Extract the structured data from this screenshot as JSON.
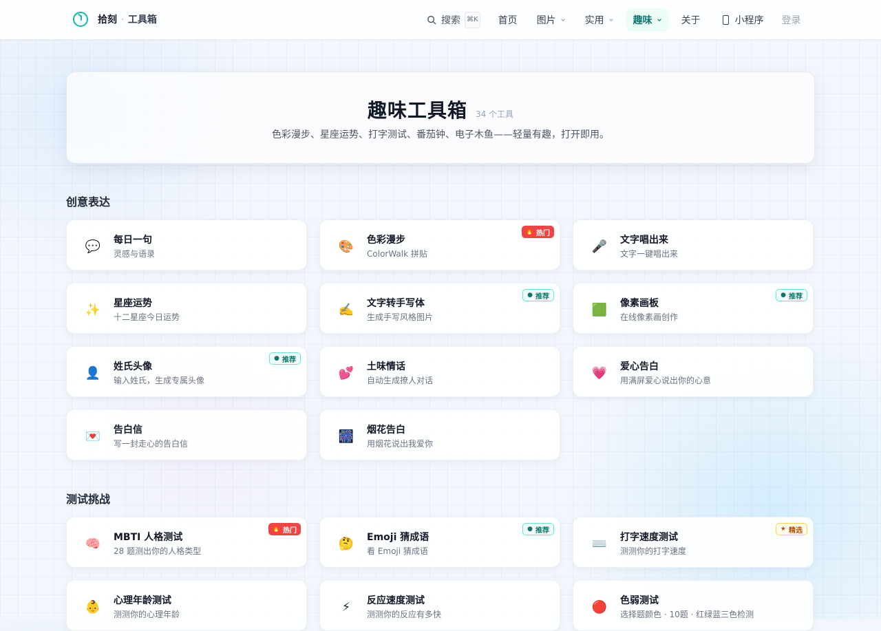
{
  "nav": {
    "brand": "拾刻",
    "brand_sep": "·",
    "brand_sub": "工具箱",
    "search_label": "搜索",
    "search_shortcut": "⌘K",
    "items": [
      {
        "label": "首页",
        "has_dropdown": false,
        "active": false
      },
      {
        "label": "图片",
        "has_dropdown": true,
        "active": false
      },
      {
        "label": "实用",
        "has_dropdown": true,
        "active": false
      },
      {
        "label": "趣味",
        "has_dropdown": true,
        "active": true
      },
      {
        "label": "关于",
        "has_dropdown": false,
        "active": false
      }
    ],
    "miniprogram_label": "小程序",
    "login_label": "登录",
    "accent_color": "#14b8a6"
  },
  "hero": {
    "title": "趣味工具箱",
    "count": "34 个工具",
    "description": "色彩漫步、星座运势、打字测试、番茄钟、电子木鱼——轻量有趣，打开即用。"
  },
  "sections": [
    {
      "title": "创意表达",
      "cards": [
        {
          "title": "每日一句",
          "subtitle": "灵感与语录",
          "icon": "speech-bubble-icon",
          "glyph": "💬",
          "badge": null
        },
        {
          "title": "色彩漫步",
          "subtitle": "ColorWalk 拼贴",
          "icon": "palette-icon",
          "glyph": "🎨",
          "badge": {
            "type": "hot",
            "mark": "🔥",
            "label": "热门"
          }
        },
        {
          "title": "文字唱出来",
          "subtitle": "文字一键唱出来",
          "icon": "microphone-icon",
          "glyph": "🎤",
          "badge": null
        },
        {
          "title": "星座运势",
          "subtitle": "十二星座今日运势",
          "icon": "sparkles-icon",
          "glyph": "✨",
          "badge": null
        },
        {
          "title": "文字转手写体",
          "subtitle": "生成手写风格图片",
          "icon": "writing-hand-icon",
          "glyph": "✍️",
          "badge": {
            "type": "rec",
            "mark": "●",
            "label": "推荐"
          }
        },
        {
          "title": "像素画板",
          "subtitle": "在线像素画创作",
          "icon": "green-square-icon",
          "glyph": "🟩",
          "badge": {
            "type": "rec",
            "mark": "●",
            "label": "推荐"
          }
        },
        {
          "title": "姓氏头像",
          "subtitle": "输入姓氏，生成专属头像",
          "icon": "person-silhouette-icon",
          "glyph": "👤",
          "badge": {
            "type": "rec",
            "mark": "●",
            "label": "推荐"
          }
        },
        {
          "title": "土味情话",
          "subtitle": "自动生成撩人对话",
          "icon": "two-hearts-icon",
          "glyph": "💕",
          "badge": null
        },
        {
          "title": "爱心告白",
          "subtitle": "用满屏爱心说出你的心意",
          "icon": "heart-icon",
          "glyph": "💗",
          "badge": null
        },
        {
          "title": "告白信",
          "subtitle": "写一封走心的告白信",
          "icon": "love-letter-icon",
          "glyph": "💌",
          "badge": null
        },
        {
          "title": "烟花告白",
          "subtitle": "用烟花说出我爱你",
          "icon": "fireworks-icon",
          "glyph": "🎆",
          "badge": null
        }
      ]
    },
    {
      "title": "测试挑战",
      "cards": [
        {
          "title": "MBTI 人格测试",
          "subtitle": "28 题测出你的人格类型",
          "icon": "brain-icon",
          "glyph": "🧠",
          "badge": {
            "type": "hot",
            "mark": "🔥",
            "label": "热门"
          }
        },
        {
          "title": "Emoji 猜成语",
          "subtitle": "看 Emoji 猜成语",
          "icon": "thinking-face-icon",
          "glyph": "🤔",
          "badge": {
            "type": "rec",
            "mark": "●",
            "label": "推荐"
          }
        },
        {
          "title": "打字速度测试",
          "subtitle": "测测你的打字速度",
          "icon": "keyboard-icon",
          "glyph": "⌨️",
          "badge": {
            "type": "pick",
            "mark": "★",
            "label": "精选"
          }
        },
        {
          "title": "心理年龄测试",
          "subtitle": "测测你的心理年龄",
          "icon": "child-face-icon",
          "glyph": "👶",
          "badge": null
        },
        {
          "title": "反应速度测试",
          "subtitle": "测测你的反应有多快",
          "icon": "lightning-icon",
          "glyph": "⚡",
          "badge": null
        },
        {
          "title": "色弱测试",
          "subtitle": "选择题颜色 · 10题 · 红绿蓝三色检测",
          "icon": "red-circle-icon",
          "glyph": "🔴",
          "badge": null
        }
      ]
    }
  ]
}
